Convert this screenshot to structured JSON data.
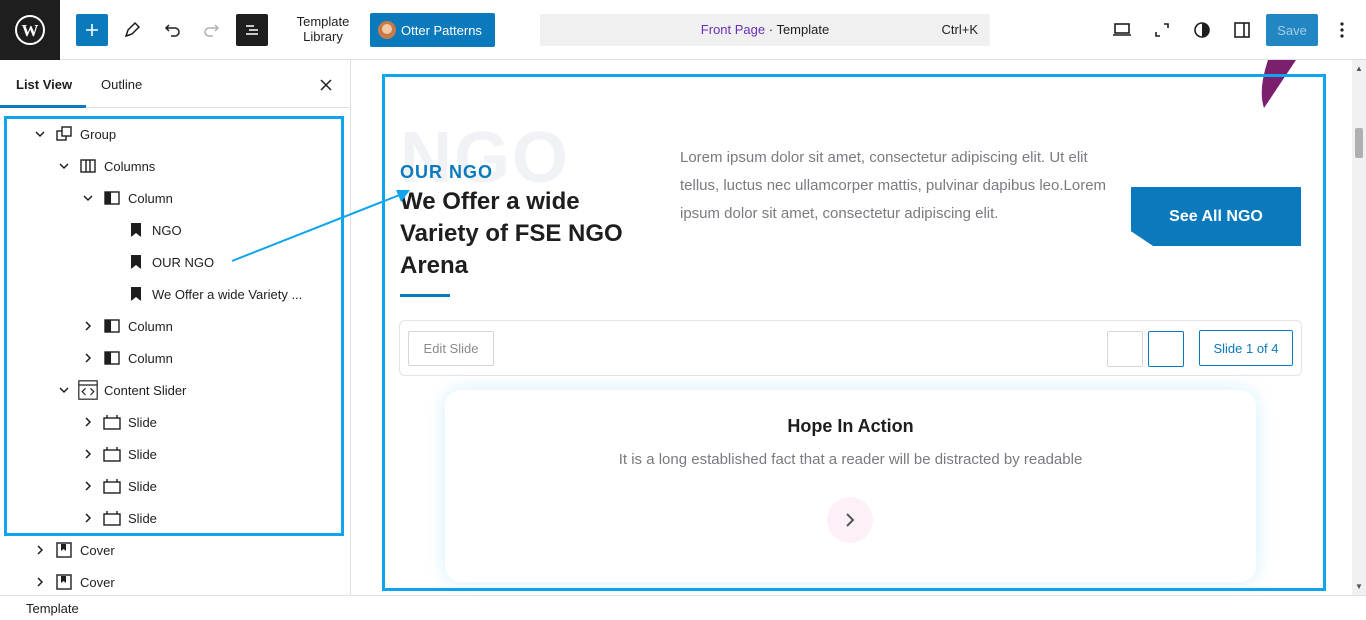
{
  "topbar": {
    "template_library_line1": "Template",
    "template_library_line2": "Library",
    "otter_label": "Otter Patterns",
    "command_front": "Front Page",
    "command_sep": " · ",
    "command_template": "Template",
    "command_shortcut": "Ctrl+K",
    "save_label": "Save"
  },
  "sidebar": {
    "tab_list_view": "List View",
    "tab_outline": "Outline",
    "tree": [
      {
        "label": "Group",
        "icon": "group-icon",
        "depth": 0,
        "chevron": "down"
      },
      {
        "label": "Columns",
        "icon": "columns-icon",
        "depth": 1,
        "chevron": "down"
      },
      {
        "label": "Column",
        "icon": "column-icon",
        "depth": 2,
        "chevron": "down"
      },
      {
        "label": "NGO",
        "icon": "bookmark-icon",
        "depth": 3,
        "chevron": "none"
      },
      {
        "label": "OUR NGO",
        "icon": "bookmark-icon",
        "depth": 3,
        "chevron": "none"
      },
      {
        "label": "We Offer a wide Variety ...",
        "icon": "bookmark-icon",
        "depth": 3,
        "chevron": "none"
      },
      {
        "label": "Column",
        "icon": "column-icon",
        "depth": 2,
        "chevron": "right"
      },
      {
        "label": "Column",
        "icon": "column-icon",
        "depth": 2,
        "chevron": "right"
      },
      {
        "label": "Content Slider",
        "icon": "content-slider-icon",
        "depth": 1,
        "chevron": "down"
      },
      {
        "label": "Slide",
        "icon": "slide-icon",
        "depth": 2,
        "chevron": "right"
      },
      {
        "label": "Slide",
        "icon": "slide-icon",
        "depth": 2,
        "chevron": "right"
      },
      {
        "label": "Slide",
        "icon": "slide-icon",
        "depth": 2,
        "chevron": "right"
      },
      {
        "label": "Slide",
        "icon": "slide-icon",
        "depth": 2,
        "chevron": "right"
      },
      {
        "label": "Cover",
        "icon": "cover-icon",
        "depth": 0,
        "chevron": "right"
      },
      {
        "label": "Cover",
        "icon": "cover-icon",
        "depth": 0,
        "chevron": "right"
      }
    ]
  },
  "canvas": {
    "bg_text": "NGO",
    "eyebrow": "OUR NGO",
    "headline": "We Offer a wide Variety of FSE NGO Arena",
    "lorem": "Lorem ipsum dolor sit amet, consectetur adipiscing elit. Ut elit tellus, luctus nec ullamcorper mattis, pulvinar dapibus leo.Lorem ipsum dolor sit amet, consectetur adipiscing elit.",
    "see_all": "See All NGO",
    "edit_slide": "Edit Slide",
    "slide_count": "Slide 1 of 4",
    "slide_title": "Hope In Action",
    "slide_text": "It is a long established fact that a reader  will be distracted by readable"
  },
  "statusbar": {
    "breadcrumb": "Template"
  },
  "colors": {
    "accent": "#0b7abd",
    "highlight": "#0ea5ec",
    "front_page": "#6a2fb8",
    "purple_stroke": "#7b1f6e"
  }
}
